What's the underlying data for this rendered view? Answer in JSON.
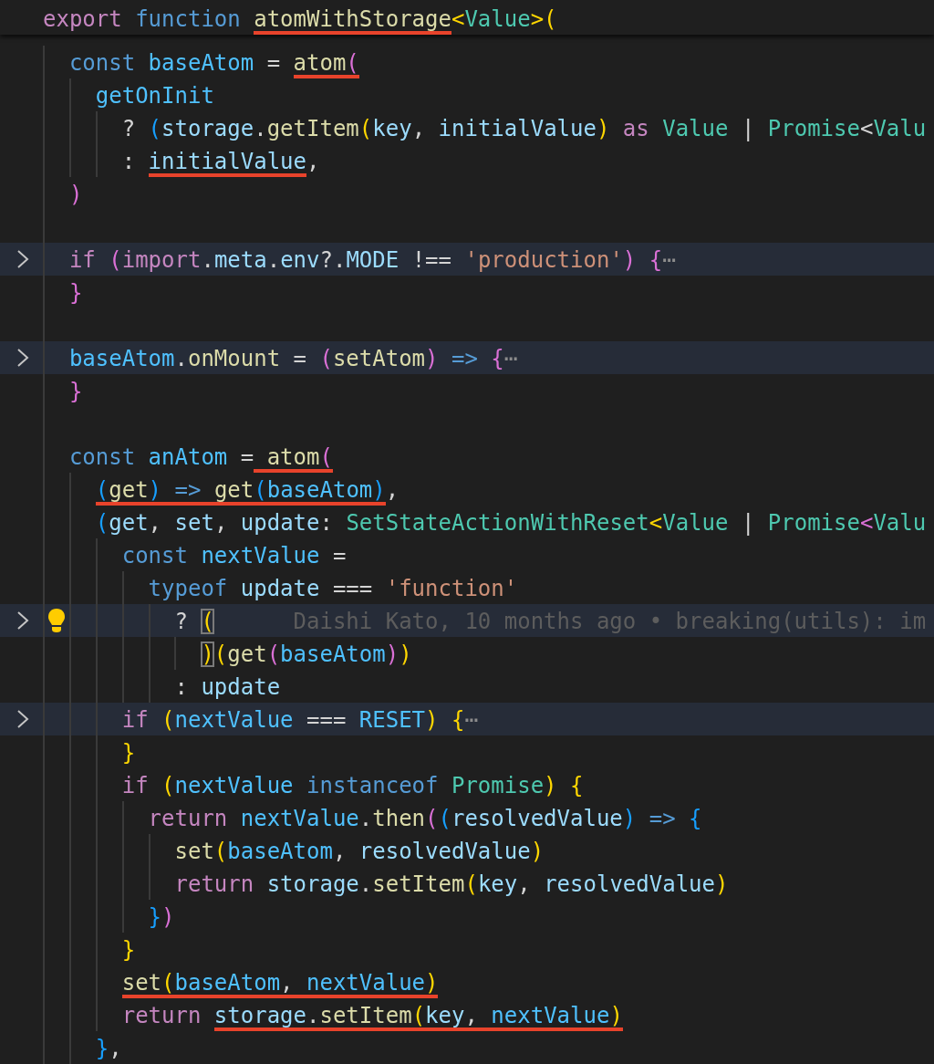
{
  "lines": [
    {
      "kind": "sticky",
      "folded": false,
      "current": false,
      "tokens": [
        {
          "text": "export",
          "kind": "control"
        },
        {
          "text": " function ",
          "kind": "keyword"
        },
        {
          "text": "atomWithStorage",
          "kind": "function",
          "underlined": true
        },
        {
          "text": "<",
          "kind": "bracket",
          "color": "#ffd700"
        },
        {
          "text": "Value",
          "kind": "type"
        },
        {
          "text": ">(",
          "kind": "bracket",
          "color": "#ffd700"
        }
      ]
    },
    {
      "kind": "code",
      "folded": false,
      "current": false,
      "tokens": [
        {
          "text": "  const ",
          "kind": "keyword"
        },
        {
          "text": "baseAtom",
          "kind": "constant"
        },
        {
          "text": " = ",
          "kind": "plain"
        },
        {
          "text": "atom",
          "kind": "function",
          "underlined": true
        },
        {
          "text": "(",
          "kind": "bracket",
          "color": "#da70d6",
          "underlined": true
        }
      ]
    },
    {
      "kind": "code",
      "folded": false,
      "current": false,
      "tokens": [
        {
          "text": "    getOnInit",
          "kind": "constant"
        }
      ]
    },
    {
      "kind": "code",
      "folded": false,
      "current": false,
      "tokens": [
        {
          "text": "      ? ",
          "kind": "plain"
        },
        {
          "text": "(",
          "kind": "bracket",
          "color": "#179fff"
        },
        {
          "text": "storage",
          "kind": "variable"
        },
        {
          "text": ".",
          "kind": "plain"
        },
        {
          "text": "getItem",
          "kind": "function"
        },
        {
          "text": "(",
          "kind": "bracket",
          "color": "#ffd700"
        },
        {
          "text": "key",
          "kind": "variable"
        },
        {
          "text": ", ",
          "kind": "plain"
        },
        {
          "text": "initialValue",
          "kind": "variable"
        },
        {
          "text": ")",
          "kind": "bracket",
          "color": "#ffd700"
        },
        {
          "text": " as ",
          "kind": "control"
        },
        {
          "text": "Value",
          "kind": "type"
        },
        {
          "text": " | ",
          "kind": "plain"
        },
        {
          "text": "Promise",
          "kind": "type"
        },
        {
          "text": "<",
          "kind": "plain"
        },
        {
          "text": "Valu",
          "kind": "type"
        }
      ]
    },
    {
      "kind": "code",
      "folded": false,
      "current": false,
      "tokens": [
        {
          "text": "      : ",
          "kind": "plain"
        },
        {
          "text": "initialValue",
          "kind": "variable",
          "underlined": true
        },
        {
          "text": ",",
          "kind": "plain"
        }
      ]
    },
    {
      "kind": "code",
      "folded": false,
      "current": false,
      "tokens": [
        {
          "text": "  )",
          "kind": "bracket",
          "color": "#da70d6"
        }
      ]
    },
    {
      "kind": "blank"
    },
    {
      "kind": "code",
      "folded": true,
      "current": false,
      "tokens": [
        {
          "text": "  if ",
          "kind": "control"
        },
        {
          "text": "(",
          "kind": "bracket",
          "color": "#da70d6"
        },
        {
          "text": "import",
          "kind": "control"
        },
        {
          "text": ".",
          "kind": "plain"
        },
        {
          "text": "meta",
          "kind": "variable"
        },
        {
          "text": ".",
          "kind": "plain"
        },
        {
          "text": "env",
          "kind": "variable"
        },
        {
          "text": "?.",
          "kind": "plain"
        },
        {
          "text": "MODE",
          "kind": "variable"
        },
        {
          "text": " !== ",
          "kind": "plain"
        },
        {
          "text": "'production'",
          "kind": "string"
        },
        {
          "text": ") {",
          "kind": "bracket",
          "color": "#da70d6"
        },
        {
          "text": "⋯",
          "kind": "fold"
        }
      ]
    },
    {
      "kind": "code",
      "folded": false,
      "current": false,
      "tokens": [
        {
          "text": "  }",
          "kind": "bracket",
          "color": "#da70d6"
        }
      ]
    },
    {
      "kind": "blank"
    },
    {
      "kind": "code",
      "folded": true,
      "current": false,
      "tokens": [
        {
          "text": "  baseAtom",
          "kind": "constant"
        },
        {
          "text": ".",
          "kind": "plain"
        },
        {
          "text": "onMount",
          "kind": "function"
        },
        {
          "text": " = ",
          "kind": "plain"
        },
        {
          "text": "(",
          "kind": "bracket",
          "color": "#da70d6"
        },
        {
          "text": "setAtom",
          "kind": "function"
        },
        {
          "text": ") ",
          "kind": "bracket",
          "color": "#da70d6"
        },
        {
          "text": "=> ",
          "kind": "keyword"
        },
        {
          "text": "{",
          "kind": "bracket",
          "color": "#da70d6"
        },
        {
          "text": "⋯",
          "kind": "fold"
        }
      ]
    },
    {
      "kind": "code",
      "folded": false,
      "current": false,
      "tokens": [
        {
          "text": "  }",
          "kind": "bracket",
          "color": "#da70d6"
        }
      ]
    },
    {
      "kind": "blank"
    },
    {
      "kind": "code",
      "folded": false,
      "current": false,
      "tokens": [
        {
          "text": "  const ",
          "kind": "keyword"
        },
        {
          "text": "anAtom",
          "kind": "constant"
        },
        {
          "text": " =",
          "kind": "plain"
        },
        {
          "text": " atom",
          "kind": "function",
          "underlined": true
        },
        {
          "text": "(",
          "kind": "bracket",
          "color": "#da70d6",
          "underlined": true
        }
      ]
    },
    {
      "kind": "code",
      "folded": false,
      "current": false,
      "tokens": [
        {
          "text": "    (",
          "kind": "bracket",
          "color": "#179fff",
          "underlined": true
        },
        {
          "text": "get",
          "kind": "function",
          "underlined": true
        },
        {
          "text": ") ",
          "kind": "bracket",
          "color": "#179fff",
          "underlined": true
        },
        {
          "text": "=> ",
          "kind": "keyword",
          "underlined": true
        },
        {
          "text": "get",
          "kind": "function",
          "underlined": true
        },
        {
          "text": "(",
          "kind": "bracket",
          "color": "#179fff",
          "underlined": true
        },
        {
          "text": "baseAtom",
          "kind": "constant",
          "underlined": true
        },
        {
          "text": ")",
          "kind": "bracket",
          "color": "#179fff",
          "underlined": true
        },
        {
          "text": ",",
          "kind": "plain"
        }
      ]
    },
    {
      "kind": "code",
      "folded": false,
      "current": false,
      "tokens": [
        {
          "text": "    (",
          "kind": "bracket",
          "color": "#179fff"
        },
        {
          "text": "get",
          "kind": "variable"
        },
        {
          "text": ", ",
          "kind": "plain"
        },
        {
          "text": "set",
          "kind": "variable"
        },
        {
          "text": ", ",
          "kind": "plain"
        },
        {
          "text": "update",
          "kind": "variable"
        },
        {
          "text": ": ",
          "kind": "plain"
        },
        {
          "text": "SetStateActionWithReset",
          "kind": "type"
        },
        {
          "text": "<",
          "kind": "bracket",
          "color": "#ffd700"
        },
        {
          "text": "Value",
          "kind": "type"
        },
        {
          "text": " | ",
          "kind": "plain"
        },
        {
          "text": "Promise",
          "kind": "type"
        },
        {
          "text": "<",
          "kind": "bracket",
          "color": "#da70d6"
        },
        {
          "text": "Valu",
          "kind": "type"
        }
      ]
    },
    {
      "kind": "code",
      "folded": false,
      "current": false,
      "tokens": [
        {
          "text": "      const ",
          "kind": "keyword"
        },
        {
          "text": "nextValue",
          "kind": "constant"
        },
        {
          "text": " =",
          "kind": "plain"
        }
      ]
    },
    {
      "kind": "code",
      "folded": false,
      "current": false,
      "tokens": [
        {
          "text": "        typeof ",
          "kind": "keyword"
        },
        {
          "text": "update",
          "kind": "variable"
        },
        {
          "text": " === ",
          "kind": "plain"
        },
        {
          "text": "'function'",
          "kind": "string"
        }
      ]
    },
    {
      "kind": "code",
      "folded": true,
      "current": true,
      "tokens": [
        {
          "text": "          ? ",
          "kind": "plain"
        },
        {
          "text": "(",
          "kind": "bracket",
          "color": "#ffd700",
          "matched": true
        }
      ],
      "blame": "Daishi Kato, 10 months ago • breaking(utils): im"
    },
    {
      "kind": "code",
      "folded": false,
      "current": false,
      "tokens": [
        {
          "text": "            )",
          "kind": "bracket",
          "color": "#ffd700",
          "matched": true
        },
        {
          "text": "(",
          "kind": "bracket",
          "color": "#ffd700"
        },
        {
          "text": "get",
          "kind": "function"
        },
        {
          "text": "(",
          "kind": "bracket",
          "color": "#da70d6"
        },
        {
          "text": "baseAtom",
          "kind": "constant"
        },
        {
          "text": ")",
          "kind": "bracket",
          "color": "#da70d6"
        },
        {
          "text": ")",
          "kind": "bracket",
          "color": "#ffd700"
        }
      ]
    },
    {
      "kind": "code",
      "folded": false,
      "current": false,
      "tokens": [
        {
          "text": "          : ",
          "kind": "plain"
        },
        {
          "text": "update",
          "kind": "variable"
        }
      ]
    },
    {
      "kind": "code",
      "folded": true,
      "current": false,
      "tokens": [
        {
          "text": "      if ",
          "kind": "control"
        },
        {
          "text": "(",
          "kind": "bracket",
          "color": "#ffd700"
        },
        {
          "text": "nextValue",
          "kind": "constant"
        },
        {
          "text": " === ",
          "kind": "plain"
        },
        {
          "text": "RESET",
          "kind": "constant"
        },
        {
          "text": ") {",
          "kind": "bracket",
          "color": "#ffd700"
        },
        {
          "text": "⋯",
          "kind": "fold"
        }
      ]
    },
    {
      "kind": "code",
      "folded": false,
      "current": false,
      "tokens": [
        {
          "text": "      }",
          "kind": "bracket",
          "color": "#ffd700"
        }
      ]
    },
    {
      "kind": "code",
      "folded": false,
      "current": false,
      "tokens": [
        {
          "text": "      if ",
          "kind": "control"
        },
        {
          "text": "(",
          "kind": "bracket",
          "color": "#ffd700"
        },
        {
          "text": "nextValue",
          "kind": "constant"
        },
        {
          "text": " instanceof ",
          "kind": "keyword"
        },
        {
          "text": "Promise",
          "kind": "type"
        },
        {
          "text": ") {",
          "kind": "bracket",
          "color": "#ffd700"
        }
      ]
    },
    {
      "kind": "code",
      "folded": false,
      "current": false,
      "tokens": [
        {
          "text": "        return ",
          "kind": "control"
        },
        {
          "text": "nextValue",
          "kind": "constant"
        },
        {
          "text": ".",
          "kind": "plain"
        },
        {
          "text": "then",
          "kind": "function"
        },
        {
          "text": "(",
          "kind": "bracket",
          "color": "#da70d6"
        },
        {
          "text": "(",
          "kind": "bracket",
          "color": "#179fff"
        },
        {
          "text": "resolvedValue",
          "kind": "variable"
        },
        {
          "text": ") ",
          "kind": "bracket",
          "color": "#179fff"
        },
        {
          "text": "=> ",
          "kind": "keyword"
        },
        {
          "text": "{",
          "kind": "bracket",
          "color": "#179fff"
        }
      ]
    },
    {
      "kind": "code",
      "folded": false,
      "current": false,
      "tokens": [
        {
          "text": "          set",
          "kind": "function"
        },
        {
          "text": "(",
          "kind": "bracket",
          "color": "#ffd700"
        },
        {
          "text": "baseAtom",
          "kind": "constant"
        },
        {
          "text": ", ",
          "kind": "plain"
        },
        {
          "text": "resolvedValue",
          "kind": "variable"
        },
        {
          "text": ")",
          "kind": "bracket",
          "color": "#ffd700"
        }
      ]
    },
    {
      "kind": "code",
      "folded": false,
      "current": false,
      "tokens": [
        {
          "text": "          return ",
          "kind": "control"
        },
        {
          "text": "storage",
          "kind": "variable"
        },
        {
          "text": ".",
          "kind": "plain"
        },
        {
          "text": "setItem",
          "kind": "function"
        },
        {
          "text": "(",
          "kind": "bracket",
          "color": "#ffd700"
        },
        {
          "text": "key",
          "kind": "variable"
        },
        {
          "text": ", ",
          "kind": "plain"
        },
        {
          "text": "resolvedValue",
          "kind": "variable"
        },
        {
          "text": ")",
          "kind": "bracket",
          "color": "#ffd700"
        }
      ]
    },
    {
      "kind": "code",
      "folded": false,
      "current": false,
      "tokens": [
        {
          "text": "        }",
          "kind": "bracket",
          "color": "#179fff"
        },
        {
          "text": ")",
          "kind": "bracket",
          "color": "#da70d6"
        }
      ]
    },
    {
      "kind": "code",
      "folded": false,
      "current": false,
      "tokens": [
        {
          "text": "      }",
          "kind": "bracket",
          "color": "#ffd700"
        }
      ]
    },
    {
      "kind": "code",
      "folded": false,
      "current": false,
      "tokens": [
        {
          "text": "      set",
          "kind": "function",
          "underlined": true
        },
        {
          "text": "(",
          "kind": "bracket",
          "color": "#ffd700",
          "underlined": true
        },
        {
          "text": "baseAtom",
          "kind": "constant",
          "underlined": true
        },
        {
          "text": ", ",
          "kind": "plain",
          "underlined": true
        },
        {
          "text": "nextValue",
          "kind": "constant",
          "underlined": true
        },
        {
          "text": ")",
          "kind": "bracket",
          "color": "#ffd700",
          "underlined": true
        }
      ]
    },
    {
      "kind": "code",
      "folded": false,
      "current": false,
      "tokens": [
        {
          "text": "      return ",
          "kind": "control"
        },
        {
          "text": "storage",
          "kind": "variable",
          "underlined": true
        },
        {
          "text": ".",
          "kind": "plain",
          "underlined": true
        },
        {
          "text": "setItem",
          "kind": "function",
          "underlined": true
        },
        {
          "text": "(",
          "kind": "bracket",
          "color": "#ffd700",
          "underlined": true
        },
        {
          "text": "key",
          "kind": "variable",
          "underlined": true
        },
        {
          "text": ", ",
          "kind": "plain",
          "underlined": true
        },
        {
          "text": "nextValue",
          "kind": "constant",
          "underlined": true
        },
        {
          "text": ")",
          "kind": "bracket",
          "color": "#ffd700",
          "underlined": true
        }
      ]
    },
    {
      "kind": "code",
      "folded": false,
      "current": false,
      "tokens": [
        {
          "text": "    }",
          "kind": "bracket",
          "color": "#179fff"
        },
        {
          "text": ",",
          "kind": "plain"
        }
      ]
    }
  ]
}
